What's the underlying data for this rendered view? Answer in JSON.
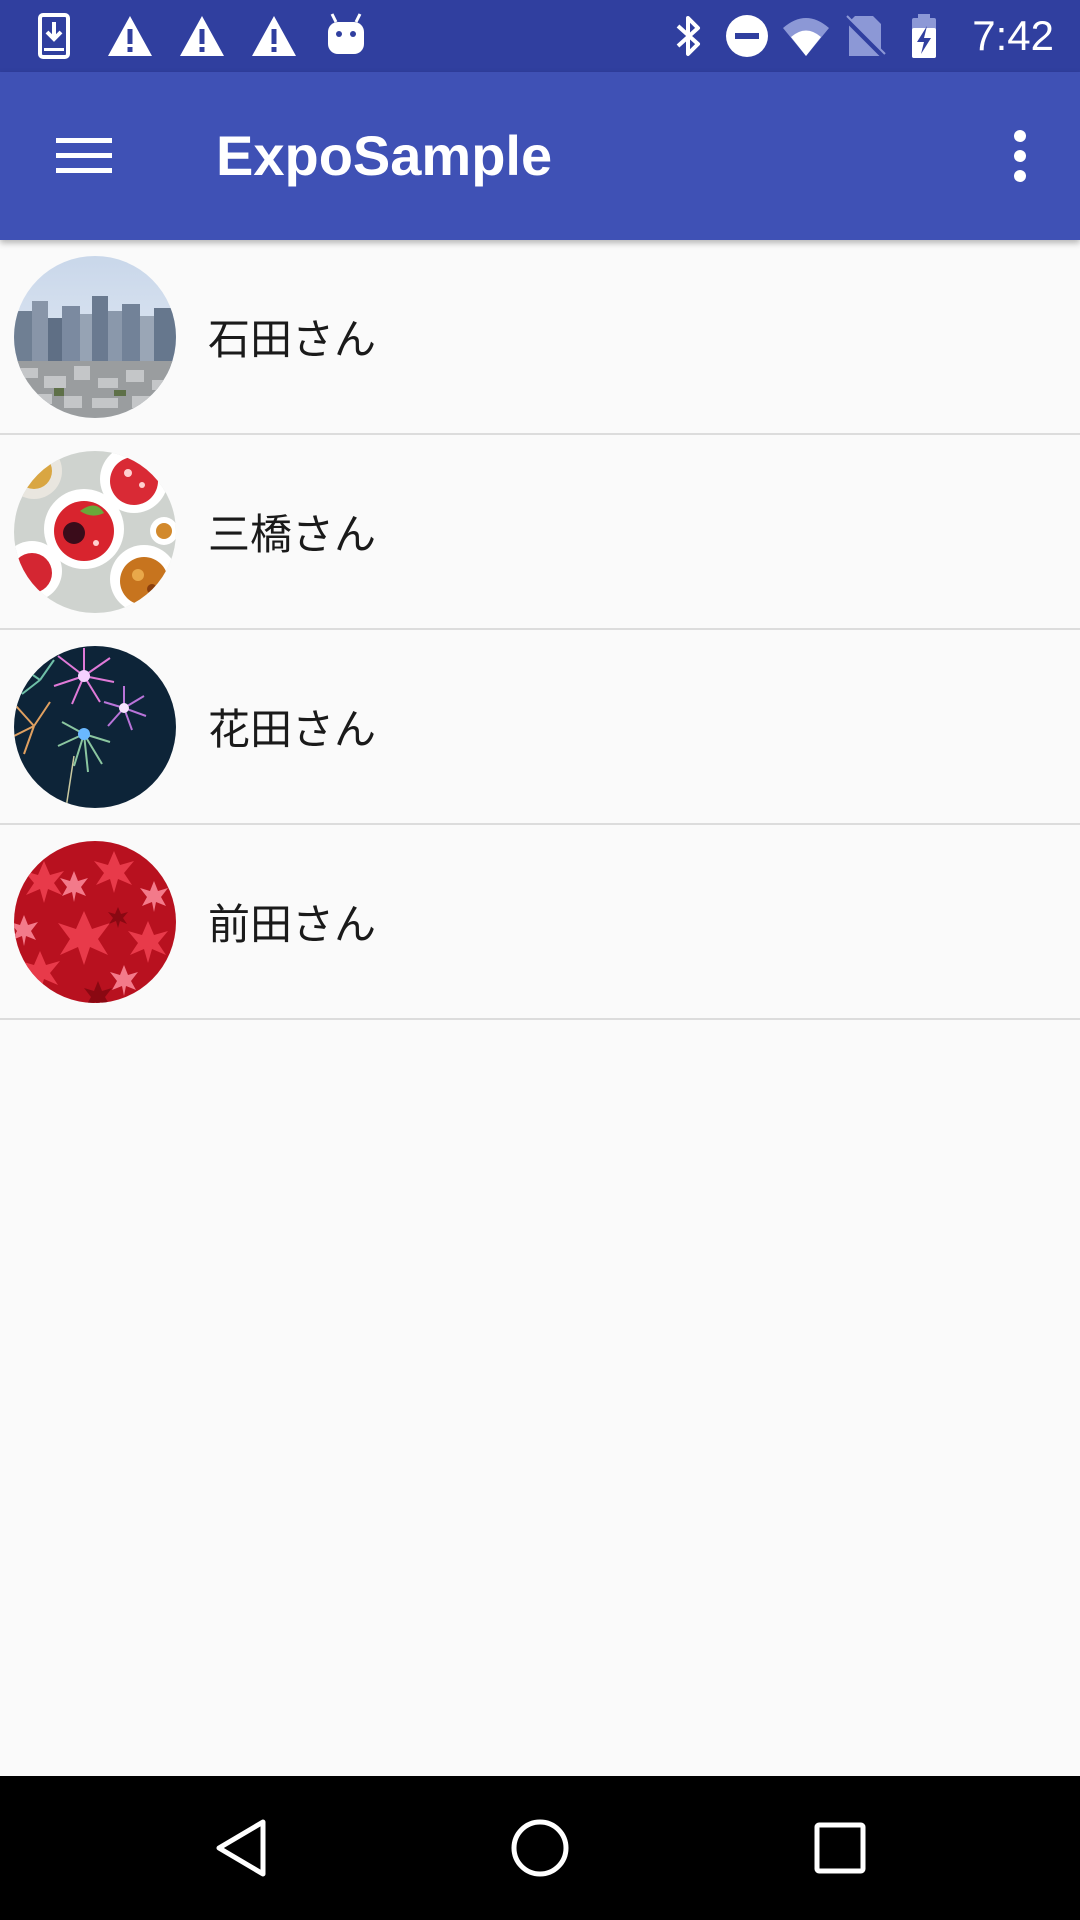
{
  "status_bar": {
    "time": "7:42",
    "left_icons": [
      "download-icon",
      "warning-icon",
      "warning-icon",
      "warning-icon",
      "android-icon"
    ],
    "right_icons": [
      "bluetooth-icon",
      "do-not-disturb-icon",
      "wifi-icon",
      "no-sim-icon",
      "battery-charging-icon"
    ]
  },
  "app_bar": {
    "title": "ExpoSample",
    "menu_icon": "hamburger-menu-icon",
    "overflow_icon": "more-vert-icon"
  },
  "contacts": [
    {
      "name": "石田さん",
      "avatar": "city-skyline-avatar"
    },
    {
      "name": "三橋さん",
      "avatar": "desserts-avatar"
    },
    {
      "name": "花田さん",
      "avatar": "fireworks-avatar"
    },
    {
      "name": "前田さん",
      "avatar": "red-maple-leaves-avatar"
    }
  ],
  "nav_bar": {
    "back_icon": "back-triangle-icon",
    "home_icon": "home-circle-icon",
    "recents_icon": "recents-square-icon"
  },
  "colors": {
    "status_bar": "#303f9f",
    "app_bar": "#3f51b5",
    "background": "#fafafa",
    "divider": "#dcdcdc",
    "nav_bar": "#000000"
  }
}
